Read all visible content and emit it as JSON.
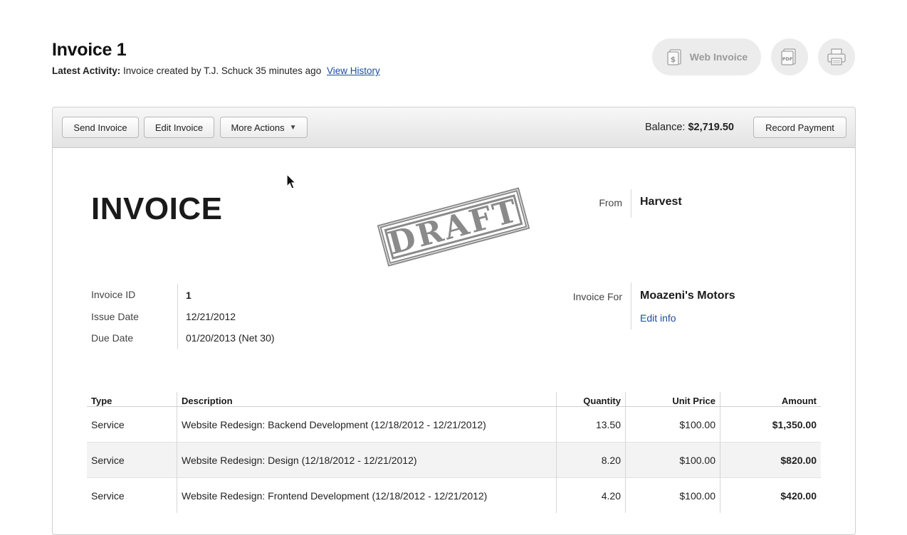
{
  "header": {
    "title": "Invoice 1",
    "activity_label": "Latest Activity:",
    "activity_text": "Invoice created by T.J. Schuck 35 minutes ago",
    "view_history": "View History"
  },
  "top_actions": {
    "web_invoice": "Web Invoice",
    "pdf_icon_text": "PDF"
  },
  "toolbar": {
    "send_invoice": "Send Invoice",
    "edit_invoice": "Edit Invoice",
    "more_actions": "More Actions",
    "balance_label": "Balance:",
    "balance_value": "$2,719.50",
    "record_payment": "Record Payment"
  },
  "invoice": {
    "heading": "INVOICE",
    "stamp": "DRAFT",
    "from_label": "From",
    "from_value": "Harvest",
    "for_label": "Invoice For",
    "for_value": "Moazeni's Motors",
    "edit_info": "Edit info",
    "meta": [
      {
        "label": "Invoice ID",
        "value": "1"
      },
      {
        "label": "Issue Date",
        "value": "12/21/2012"
      },
      {
        "label": "Due Date",
        "value": "01/20/2013 (Net 30)"
      }
    ]
  },
  "table": {
    "headers": [
      "Type",
      "Description",
      "Quantity",
      "Unit Price",
      "Amount"
    ],
    "rows": [
      [
        "Service",
        "Website Redesign: Backend Development (12/18/2012 - 12/21/2012)",
        "13.50",
        "$100.00",
        "$1,350.00"
      ],
      [
        "Service",
        "Website Redesign: Design (12/18/2012 - 12/21/2012)",
        "8.20",
        "$100.00",
        "$820.00"
      ],
      [
        "Service",
        "Website Redesign: Frontend Development (12/18/2012 - 12/21/2012)",
        "4.20",
        "$100.00",
        "$420.00"
      ]
    ]
  },
  "icons": {
    "web_invoice": "dollar-document-icon",
    "pdf": "pdf-icon",
    "print": "printer-icon",
    "more_caret": "caret-down-icon",
    "cursor": "mouse-pointer-icon"
  }
}
